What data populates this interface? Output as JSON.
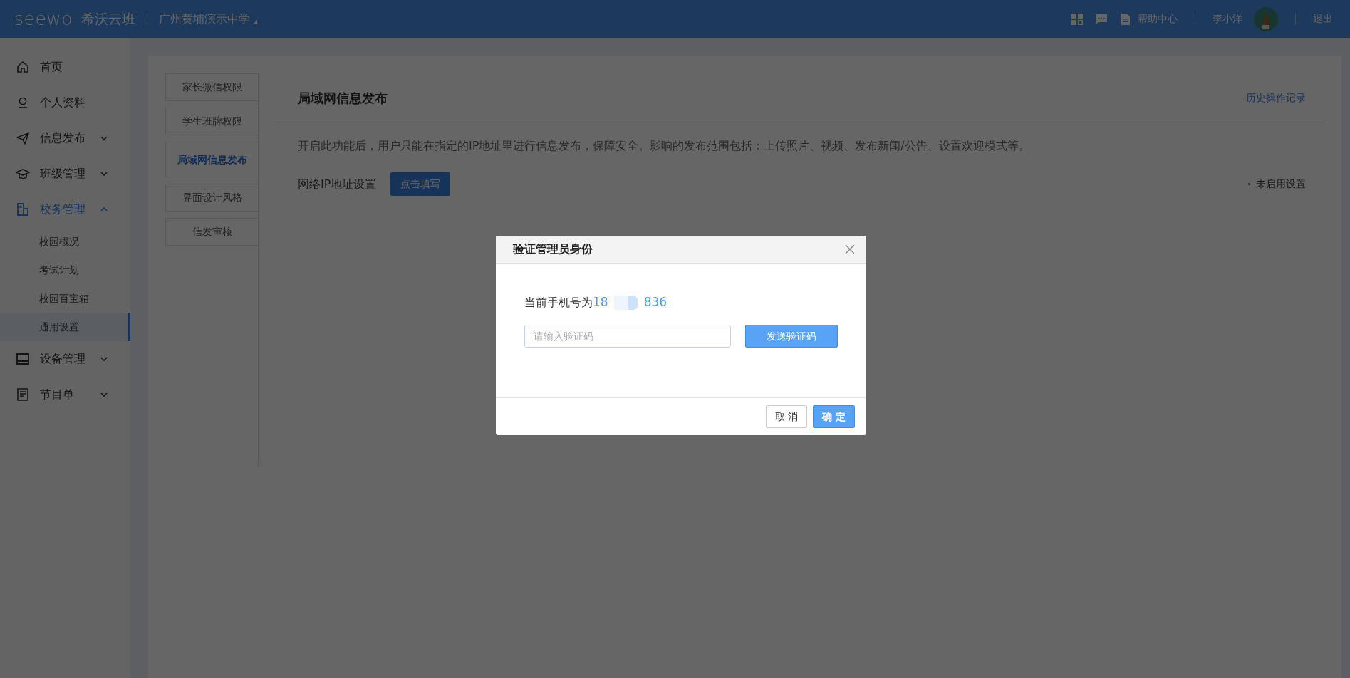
{
  "header": {
    "logo": "seewo",
    "product": "希沃云班",
    "school": "广州黄埔演示中学",
    "help": "帮助中心",
    "user": "李小洋",
    "logout": "退出"
  },
  "sidebar": {
    "items": [
      {
        "label": "首页",
        "kind": "home",
        "active": false
      },
      {
        "label": "个人资料",
        "kind": "user",
        "active": false
      },
      {
        "label": "信息发布",
        "kind": "send",
        "active": false,
        "expanded": false
      },
      {
        "label": "班级管理",
        "kind": "cap",
        "active": false,
        "expanded": false
      },
      {
        "label": "校务管理",
        "kind": "school",
        "active": true,
        "expanded": true,
        "children": [
          {
            "label": "校园概况",
            "selected": false
          },
          {
            "label": "考试计划",
            "selected": false
          },
          {
            "label": "校园百宝箱",
            "selected": false
          },
          {
            "label": "通用设置",
            "selected": true
          }
        ]
      },
      {
        "label": "设备管理",
        "kind": "monitor",
        "active": false,
        "expanded": false
      },
      {
        "label": "节目单",
        "kind": "list",
        "active": false,
        "expanded": false
      }
    ]
  },
  "subtabs": [
    {
      "label": "家长微信权限",
      "selected": false
    },
    {
      "label": "学生班牌权限",
      "selected": false
    },
    {
      "label": "局域网信息发布",
      "selected": true
    },
    {
      "label": "界面设计风格",
      "selected": false
    },
    {
      "label": "信发审核",
      "selected": false
    }
  ],
  "panel": {
    "title": "局域网信息发布",
    "history_link": "历史操作记录",
    "description": "开启此功能后，用户只能在指定的IP地址里进行信息发布，保障安全。影响的发布范围包括：上传照片、视频、发布新闻/公告、设置欢迎模式等。",
    "ip_label": "网络IP地址设置",
    "fill_button": "点击填写",
    "status": "未启用设置"
  },
  "dialog": {
    "title": "验证管理员身份",
    "phone_label": "当前手机号为",
    "phone_start": "18",
    "phone_redacted": true,
    "phone_end": "836",
    "code_input": {
      "placeholder": "请输入验证码"
    },
    "send_button": "发送验证码",
    "cancel_button": "取 消",
    "ok_button": "确 定"
  }
}
